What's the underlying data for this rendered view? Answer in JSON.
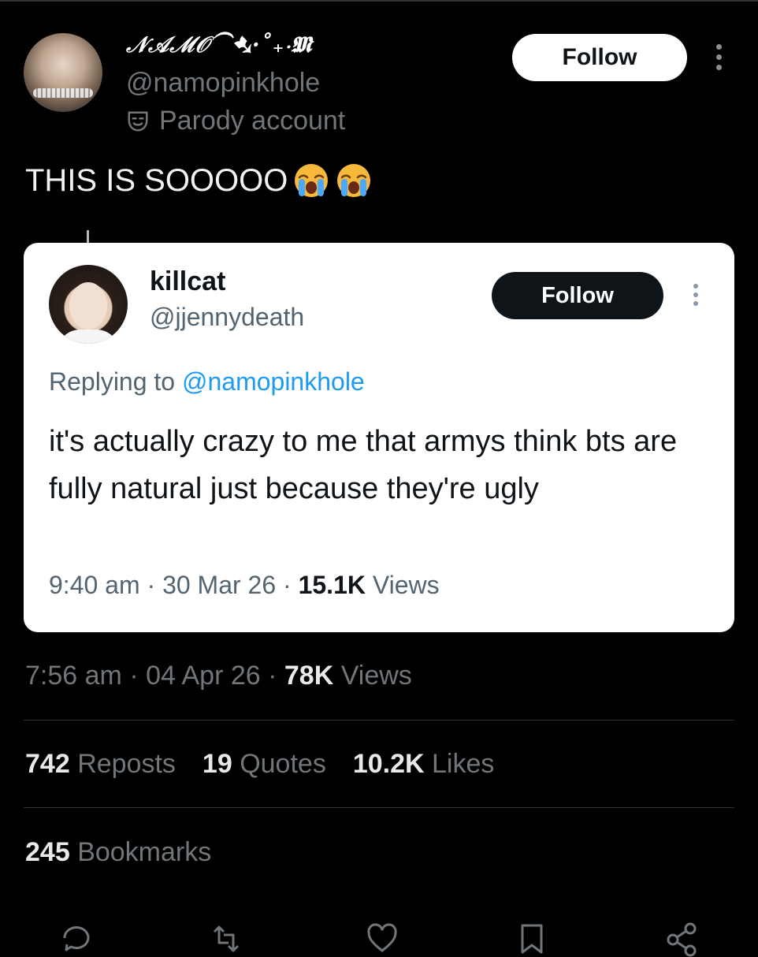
{
  "author": {
    "display_name": "𝒩𝒜ℳ𝒪⁀➷·˚₊‧𝕸",
    "handle": "@namopinkhole",
    "label": "Parody account",
    "follow_label": "Follow"
  },
  "tweet": {
    "text": "THIS IS SOOOOO",
    "emojis": [
      "loudly-crying-face",
      "loudly-crying-face"
    ]
  },
  "quote": {
    "display_name": "killcat",
    "handle": "@jjennydeath",
    "follow_label": "Follow",
    "replying_prefix": "Replying to",
    "replying_to": "@namopinkhole",
    "body": "it's actually crazy to me that armys think bts are fully natural just because they're ugly",
    "time": "9:40 am",
    "date": "30 Mar 26",
    "views_count": "15.1K",
    "views_label": "Views"
  },
  "meta": {
    "time": "7:56 am",
    "date": "04 Apr 26",
    "views_count": "78K",
    "views_label": "Views",
    "separator": "·"
  },
  "stats": {
    "reposts_count": "742",
    "reposts_label": "Reposts",
    "quotes_count": "19",
    "quotes_label": "Quotes",
    "likes_count": "10.2K",
    "likes_label": "Likes",
    "bookmarks_count": "245",
    "bookmarks_label": "Bookmarks"
  },
  "actions": [
    "reply-icon",
    "repost-icon",
    "like-icon",
    "bookmark-icon",
    "share-icon"
  ],
  "colors": {
    "background": "#000000",
    "muted_text": "#71767b",
    "link": "#1d9bf0"
  }
}
